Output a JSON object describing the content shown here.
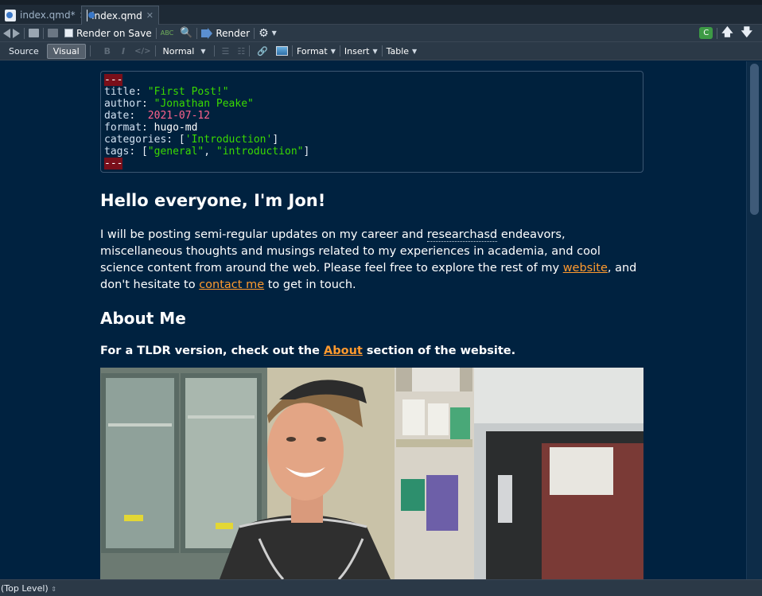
{
  "tabs": [
    {
      "label": "index.qmd*",
      "active": false
    },
    {
      "label": "index.qmd",
      "active": true
    }
  ],
  "toolbar": {
    "render_on_save_label": "Render on Save",
    "spell_label": "ABC",
    "render_label": "Render",
    "addin_badge": "C"
  },
  "format_bar": {
    "source_label": "Source",
    "visual_label": "Visual",
    "bold_label": "B",
    "italic_label": "I",
    "code_label": "</>",
    "style_label": "Normal",
    "format_label": "Format",
    "insert_label": "Insert",
    "table_label": "Table"
  },
  "yaml": {
    "delim": "---",
    "title_key": "title",
    "title_value": "\"First Post!\"",
    "author_key": "author",
    "author_value": "\"Jonathan Peake\"",
    "date_key": "date",
    "date_value": "2021-07-12",
    "format_key": "format",
    "format_value": "hugo-md",
    "categories_key": "categories",
    "categories_value": "'Introduction'",
    "tags_key": "tags",
    "tags_value_1": "\"general\"",
    "tags_value_2": "\"introduction\""
  },
  "doc": {
    "heading1": "Hello everyone, I'm Jon!",
    "para_part1": "I will be posting semi-regular updates on my career and ",
    "para_misspelled": "researchasd",
    "para_part2": " endeavors, miscellaneous thoughts and musings related to my experiences in academia, and cool science content from around the web. Please feel free to explore the rest of my ",
    "link_website": "website",
    "para_part3": ", and don't hesitate to ",
    "link_contact": "contact me",
    "para_part4": " to get in touch.",
    "heading2": "About Me",
    "tldr_part1": "For a TLDR version, check out the ",
    "link_about": "About",
    "tldr_part2": " section of the website."
  },
  "status": {
    "scope": "(Top Level)"
  },
  "colors": {
    "background": "#002240",
    "link": "#ff9a2e",
    "string": "#3ad900",
    "number": "#ff628c"
  }
}
